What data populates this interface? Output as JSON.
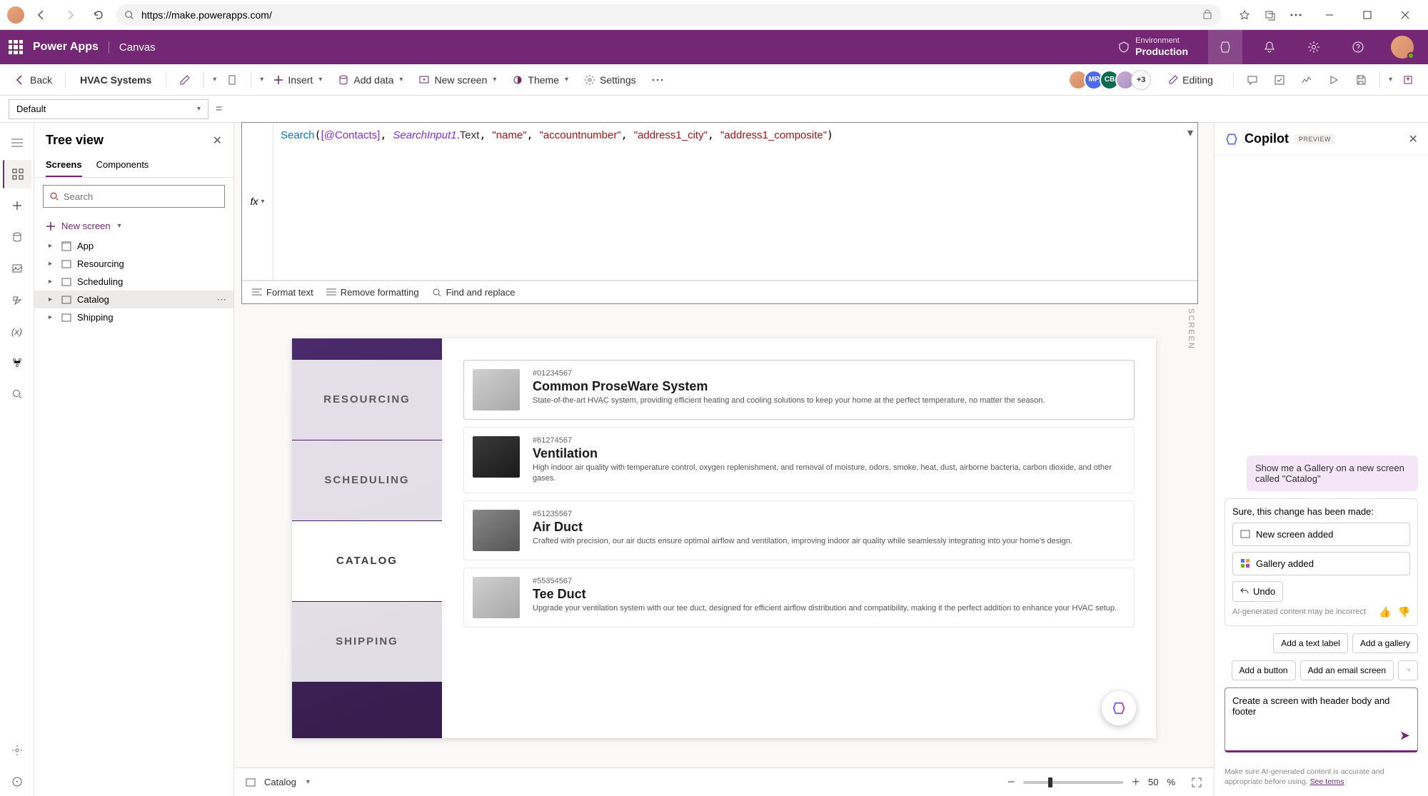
{
  "browser": {
    "url": "https://make.powerapps.com/"
  },
  "header": {
    "brand": "Power Apps",
    "sub": "Canvas",
    "env_label": "Environment",
    "env_name": "Production"
  },
  "command": {
    "back": "Back",
    "app_name": "HVAC Systems",
    "insert": "Insert",
    "add_data": "Add data",
    "new_screen": "New screen",
    "theme": "Theme",
    "settings": "Settings",
    "editing": "Editing",
    "presence_more": "+3"
  },
  "property": {
    "selected": "Default"
  },
  "formula": {
    "fx": "fx",
    "fn": "Search",
    "ref": "[@Contacts]",
    "var": "SearchInput1",
    "prop": ".Text",
    "s1": "\"name\"",
    "s2": "\"accountnumber\"",
    "s3": "\"address1_city\"",
    "s4": "\"address1_composite\"",
    "format": "Format text",
    "remove": "Remove formatting",
    "find": "Find and replace"
  },
  "tree": {
    "title": "Tree view",
    "tabs": {
      "screens": "Screens",
      "components": "Components"
    },
    "search_placeholder": "Search",
    "new_screen": "New screen",
    "items": [
      {
        "label": "App"
      },
      {
        "label": "Resourcing"
      },
      {
        "label": "Scheduling"
      },
      {
        "label": "Catalog"
      },
      {
        "label": "Shipping"
      }
    ]
  },
  "preview": {
    "screen_tag": "SCREEN",
    "nav": [
      "RESOURCING",
      "SCHEDULING",
      "CATALOG",
      "SHIPPING"
    ],
    "cards": [
      {
        "sku": "#01234567",
        "title": "Common ProseWare System",
        "desc": "State-of-the-art HVAC system, providing efficient heating and cooling solutions to keep your home at the perfect temperature, no matter the season."
      },
      {
        "sku": "#61274567",
        "title": "Ventilation",
        "desc": "High indoor air quality with temperature control, oxygen replenishment, and removal of moisture, odors, smoke, heat, dust, airborne bacteria, carbon dioxide, and other gases."
      },
      {
        "sku": "#51235567",
        "title": "Air Duct",
        "desc": "Crafted with precision, our air ducts ensure optimal airflow and ventilation, improving indoor air quality while seamlessly integrating into your home's design."
      },
      {
        "sku": "#55354567",
        "title": "Tee Duct",
        "desc": "Upgrade your ventilation system with our tee duct, designed for efficient airflow distribution and compatibility, making it the perfect addition to enhance your HVAC setup."
      }
    ]
  },
  "footer": {
    "selector": "Catalog",
    "zoom_value": "50",
    "zoom_unit": "%"
  },
  "copilot": {
    "title": "Copilot",
    "badge": "PREVIEW",
    "user_msg": "Show me a Gallery on a new screen called \"Catalog\"",
    "bot_intro": "Sure, this change has been made:",
    "action1": "New screen added",
    "action2": "Gallery added",
    "undo": "Undo",
    "feedback_note": "AI-generated content may be incorrect",
    "suggest": [
      "Add a text label",
      "Add a gallery",
      "Add a button",
      "Add an email screen"
    ],
    "input_text": "Create a screen with header body and footer",
    "disclaimer_pre": "Make sure AI-generated content is accurate and appropriate before using. ",
    "disclaimer_link": "See terms"
  }
}
